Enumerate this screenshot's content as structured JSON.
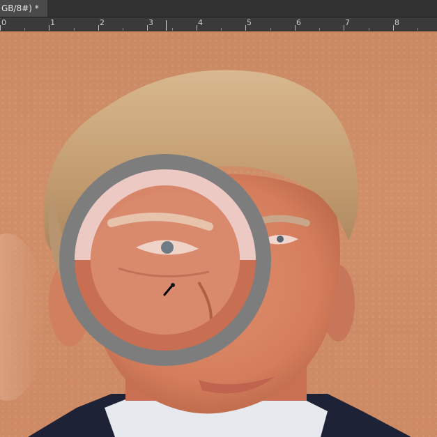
{
  "document": {
    "tab_title": "GB/8#) *"
  },
  "ruler": {
    "labels": [
      "0",
      "1",
      "2",
      "3",
      "4",
      "5",
      "6",
      "7",
      "8"
    ]
  },
  "colors": {
    "sample_new": "#eccac3",
    "sample_current": "#c86e52",
    "ring_outer": "#7d7d7d",
    "background": "#c98a63"
  },
  "tool": {
    "name": "eyedropper",
    "icon": "eyedropper-icon"
  }
}
